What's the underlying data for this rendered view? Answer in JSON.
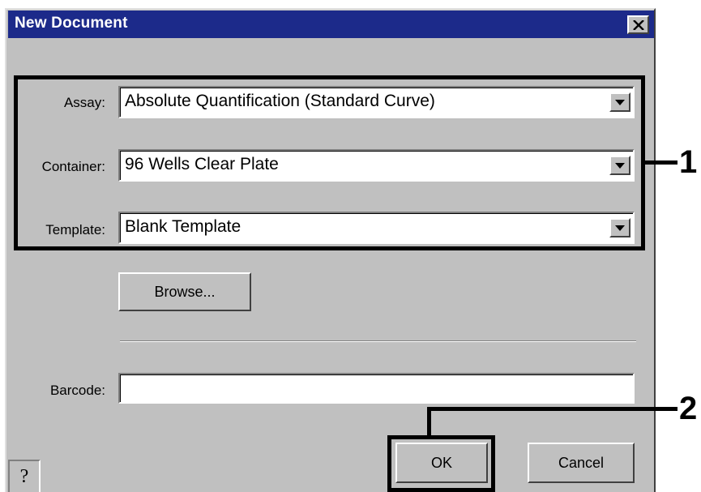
{
  "dialog": {
    "title": "New Document",
    "close_icon": "close-icon"
  },
  "fields": {
    "assay": {
      "label": "Assay:",
      "value": "Absolute Quantification (Standard Curve)"
    },
    "container": {
      "label": "Container:",
      "value": "96 Wells Clear Plate"
    },
    "template": {
      "label": "Template:",
      "value": "Blank Template"
    },
    "barcode": {
      "label": "Barcode:",
      "value": ""
    }
  },
  "buttons": {
    "browse": "Browse...",
    "ok": "OK",
    "cancel": "Cancel",
    "help": "?"
  },
  "callouts": {
    "one": "1",
    "two": "2"
  },
  "colors": {
    "titlebar": "#1c2a8a",
    "face": "#c0c0c0"
  }
}
